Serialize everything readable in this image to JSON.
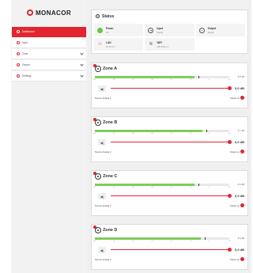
{
  "brand": {
    "name": "MONACOR",
    "accent": "#e2252f",
    "meter_green": "#7fcc5b"
  },
  "sidebar": {
    "items": [
      {
        "label": "Dashboard",
        "icon": "circle-icon",
        "active": true
      },
      {
        "label": "Input",
        "icon": "circle-icon"
      },
      {
        "label": "Zone",
        "icon": "circle-icon",
        "expandable": true
      },
      {
        "label": "Output",
        "icon": "circle-icon",
        "expandable": true
      },
      {
        "label": "Settings",
        "icon": "gear-icon",
        "expandable": true
      }
    ]
  },
  "status": {
    "title": "Status",
    "items": [
      {
        "label": "Power",
        "value": "On",
        "icon": "power-led-icon"
      },
      {
        "label": "Input",
        "value": "Signal",
        "icon": "input-icon"
      },
      {
        "label": "Output",
        "value": "Signal",
        "icon": "output-icon"
      },
      {
        "label": "LAN",
        "value": "10.10.1.1",
        "icon": "lan-icon"
      },
      {
        "label": "WiFi",
        "value": "192.168.4.1",
        "icon": "wifi-icon"
      }
    ]
  },
  "ticks": [
    "-60",
    "-50",
    "-40",
    "-30",
    "-20",
    "-10",
    "0",
    "+10"
  ],
  "zones": [
    {
      "name": "Zone A",
      "meter_value": "-6.6 dB",
      "meter_fraction": 0.74,
      "peak_fraction": 0.77,
      "volume": "0,0 dB",
      "volume_fraction": 1.0,
      "source": "Source Analog 1",
      "output": "Output on"
    },
    {
      "name": "Zone B",
      "meter_value": "-5.7 dB",
      "meter_fraction": 0.8,
      "peak_fraction": 0.83,
      "volume": "0,0 dB",
      "volume_fraction": 1.0,
      "source": "Source Analog 2",
      "output": "Output on"
    },
    {
      "name": "Zone C",
      "meter_value": "-6.6 dB",
      "meter_fraction": 0.74,
      "peak_fraction": 0.77,
      "volume": "0,0 dB",
      "volume_fraction": 1.0,
      "source": "Source Analog 3",
      "output": "Output on"
    },
    {
      "name": "Zone D",
      "meter_value": "-5.9 dB",
      "meter_fraction": 0.79,
      "peak_fraction": 0.82,
      "volume": "0,0 dB",
      "volume_fraction": 1.0,
      "source": "Source Analog 4",
      "output": "Output on"
    }
  ]
}
